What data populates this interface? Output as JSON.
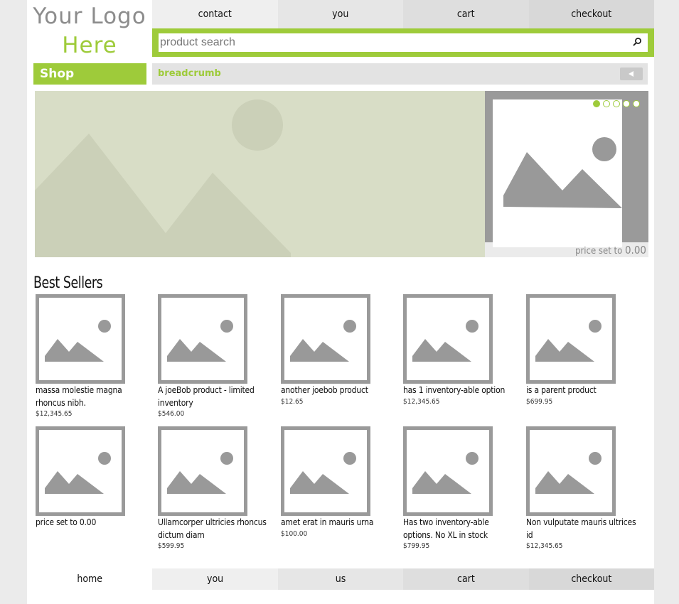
{
  "logo": {
    "line1": "Your Logo",
    "line2": "Here"
  },
  "top_nav": [
    "contact",
    "you",
    "cart",
    "checkout"
  ],
  "search": {
    "placeholder": "product search",
    "value": ""
  },
  "shop_label": "Shop",
  "breadcrumb": "breadcrumb",
  "slider": {
    "dots": 5,
    "active_dot": 1,
    "price_label": "price set to ",
    "price_value": "0.00"
  },
  "best_sellers": {
    "title": "Best Sellers",
    "products": [
      {
        "name": "massa molestie magna rhoncus nibh.",
        "price": "$12,345.65"
      },
      {
        "name": "A joeBob product - limited inventory",
        "price": "$546.00"
      },
      {
        "name": "another joebob product",
        "price": "$12.65"
      },
      {
        "name": "has 1 inventory-able option",
        "price": "$12,345.65"
      },
      {
        "name": "is a parent product",
        "price": "$699.95"
      },
      {
        "name": "price set to 0.00",
        "price": ""
      },
      {
        "name": "Ullamcorper ultricies rhoncus dictum diam",
        "price": "$599.95"
      },
      {
        "name": "amet erat in mauris urna",
        "price": "$100.00"
      },
      {
        "name": "Has two inventory-able options. No XL in stock",
        "price": "$799.95"
      },
      {
        "name": "Non vulputate mauris ultrices id",
        "price": "$12,345.65"
      }
    ]
  },
  "footer_nav": [
    "home",
    "you",
    "us",
    "cart",
    "checkout"
  ],
  "colors": {
    "accent": "#9ecb3a",
    "frame": "#9a9a9a",
    "hero_bg": "#d8ddc6"
  }
}
